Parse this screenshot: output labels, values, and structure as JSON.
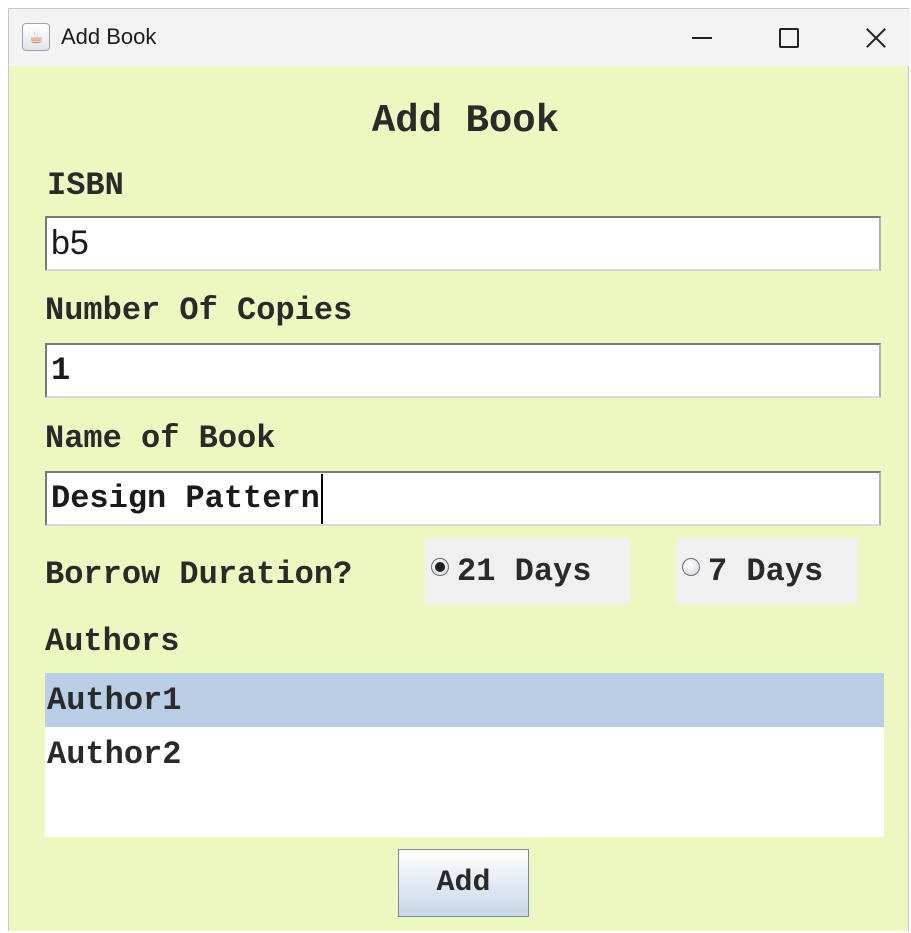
{
  "window": {
    "title": "Add Book",
    "icon": "java-cup-icon"
  },
  "form": {
    "heading": "Add Book",
    "isbn_label": "ISBN",
    "isbn_value": "b5",
    "copies_label": "Number Of Copies",
    "copies_value": "1",
    "name_label": "Name of Book",
    "name_value": "Design Pattern",
    "duration_label": "Borrow Duration?",
    "duration_options": [
      {
        "label": "21 Days",
        "selected": true
      },
      {
        "label": "7 Days",
        "selected": false
      }
    ],
    "authors_label": "Authors",
    "authors": [
      {
        "name": "Author1",
        "selected": true
      },
      {
        "name": "Author2",
        "selected": false
      }
    ],
    "add_button": "Add"
  },
  "colors": {
    "background": "#ecf8bf",
    "selection": "#b8cfe5",
    "titlebar": "#f3f3f3"
  }
}
